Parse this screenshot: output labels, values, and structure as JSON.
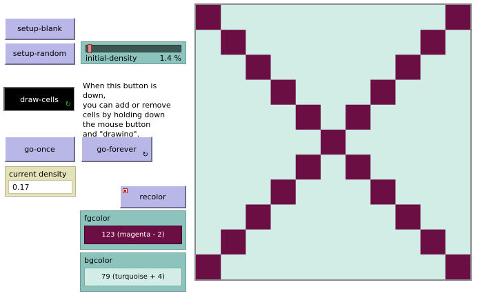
{
  "buttons": {
    "setup_blank": "setup-blank",
    "setup_random": "setup-random",
    "draw_cells": "draw-cells",
    "go_once": "go-once",
    "go_forever": "go-forever",
    "recolor": "recolor"
  },
  "slider": {
    "label": "initial-density",
    "value": "1.4 %",
    "fraction": 0.014
  },
  "note": "When this button is down,\nyou can add or remove\ncells by holding down\nthe mouse button\nand \"drawing\".",
  "monitor": {
    "label": "current density",
    "value": "0.17"
  },
  "fgcolor": {
    "label": "fgcolor",
    "value": "123 (magenta - 2)",
    "color": "#6b0e43"
  },
  "bgcolor": {
    "label": "bgcolor",
    "value": "79 (turquoise + 4)",
    "color": "#d2ece6"
  },
  "icons": {
    "forever": "forever-icon",
    "recolor_indicator": "red-x-icon"
  },
  "world": {
    "grid_size": 11,
    "live_cells": [
      [
        0,
        0
      ],
      [
        0,
        10
      ],
      [
        1,
        1
      ],
      [
        1,
        9
      ],
      [
        2,
        2
      ],
      [
        2,
        8
      ],
      [
        3,
        3
      ],
      [
        3,
        7
      ],
      [
        4,
        4
      ],
      [
        4,
        6
      ],
      [
        5,
        5
      ],
      [
        6,
        4
      ],
      [
        6,
        6
      ],
      [
        7,
        3
      ],
      [
        7,
        7
      ],
      [
        8,
        2
      ],
      [
        8,
        8
      ],
      [
        9,
        1
      ],
      [
        9,
        9
      ],
      [
        10,
        0
      ],
      [
        10,
        10
      ]
    ]
  }
}
